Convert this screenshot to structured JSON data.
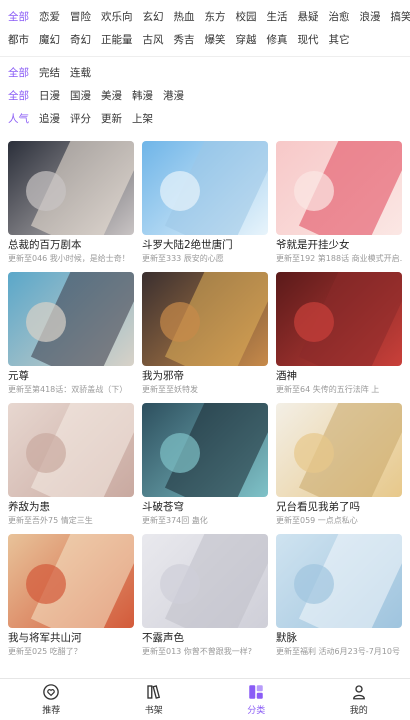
{
  "filters": {
    "genre_row1": [
      "全部",
      "恋爱",
      "冒险",
      "欢乐向",
      "玄幻",
      "热血",
      "东方",
      "校园",
      "生活",
      "悬疑",
      "治愈",
      "浪漫",
      "搞笑"
    ],
    "genre_row2": [
      "都市",
      "魔幻",
      "奇幻",
      "正能量",
      "古风",
      "秀吉",
      "爆笑",
      "穿越",
      "修真",
      "现代",
      "其它"
    ],
    "status": [
      "全部",
      "完结",
      "连载"
    ],
    "region": [
      "全部",
      "日漫",
      "国漫",
      "美漫",
      "韩漫",
      "港漫"
    ],
    "sort": [
      "人气",
      "追漫",
      "评分",
      "更新",
      "上架"
    ],
    "active": {
      "genre": "全部",
      "status": "全部",
      "region": "全部",
      "sort": "人气"
    }
  },
  "comics": [
    {
      "title": "总裁的百万剧本",
      "update": "更新至046 我小时候，是给士奇！"
    },
    {
      "title": "斗罗大陆2绝世唐门",
      "update": "更新至333 辰安的心愿"
    },
    {
      "title": "爷就是开挂少女",
      "update": "更新至192 第188话 商业模式开启…"
    },
    {
      "title": "元尊",
      "update": "更新至第418话：双骄盖战（下）"
    },
    {
      "title": "我为邪帝",
      "update": "更新至至妖特发"
    },
    {
      "title": "酒神",
      "update": "更新至64 失传的五行法阵 上"
    },
    {
      "title": "养敌为患",
      "update": "更新至吾外75 情定三生"
    },
    {
      "title": "斗破苍穹",
      "update": "更新至374回 蛊化"
    },
    {
      "title": "兄台看见我弟了吗",
      "update": "更新至059 一点点私心"
    },
    {
      "title": "我与将军共山河",
      "update": "更新至025 吃醋了？"
    },
    {
      "title": "不露声色",
      "update": "更新至013 你曾不曾跟我一样?"
    },
    {
      "title": "默脉",
      "update": "更新至福利 活动6月23号-7月10号"
    }
  ],
  "nav": [
    {
      "label": "推荐",
      "icon": "heart-icon"
    },
    {
      "label": "书架",
      "icon": "bookshelf-icon"
    },
    {
      "label": "分类",
      "icon": "category-icon",
      "active": true
    },
    {
      "label": "我的",
      "icon": "user-icon"
    }
  ],
  "colors": {
    "accent": "#8a5cf6",
    "text": "#222222",
    "muted": "#999999"
  }
}
